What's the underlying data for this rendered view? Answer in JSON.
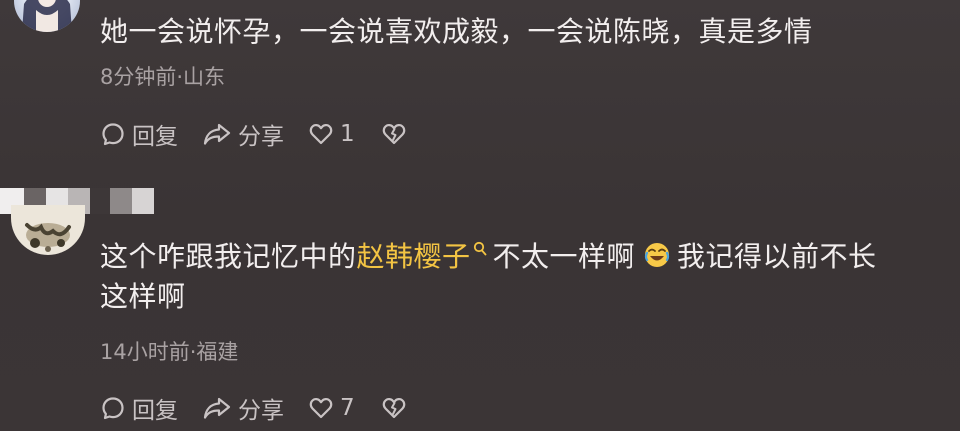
{
  "comments": [
    {
      "text": "她一会说怀孕，一会说喜欢成毅，一会说陈晓，真是多情",
      "meta": "8分钟前·山东",
      "reply_label": "回复",
      "share_label": "分享",
      "like_count": "1"
    },
    {
      "text_before": "这个咋跟我记忆中的",
      "highlight": "赵韩樱子",
      "text_middle": "不太一样啊",
      "text_after_line1": "我记得以前不长",
      "text_line2": "这样啊",
      "meta": "14小时前·福建",
      "reply_label": "回复",
      "share_label": "分享",
      "like_count": "7"
    }
  ],
  "colors": {
    "background": "#3b3536",
    "text": "#f2eeee",
    "meta": "#a9a2a3",
    "highlight": "#f3c443"
  },
  "icons": [
    "reply-icon",
    "share-icon",
    "like-icon",
    "dislike-icon",
    "search-icon",
    "laughing-emoji-icon"
  ]
}
